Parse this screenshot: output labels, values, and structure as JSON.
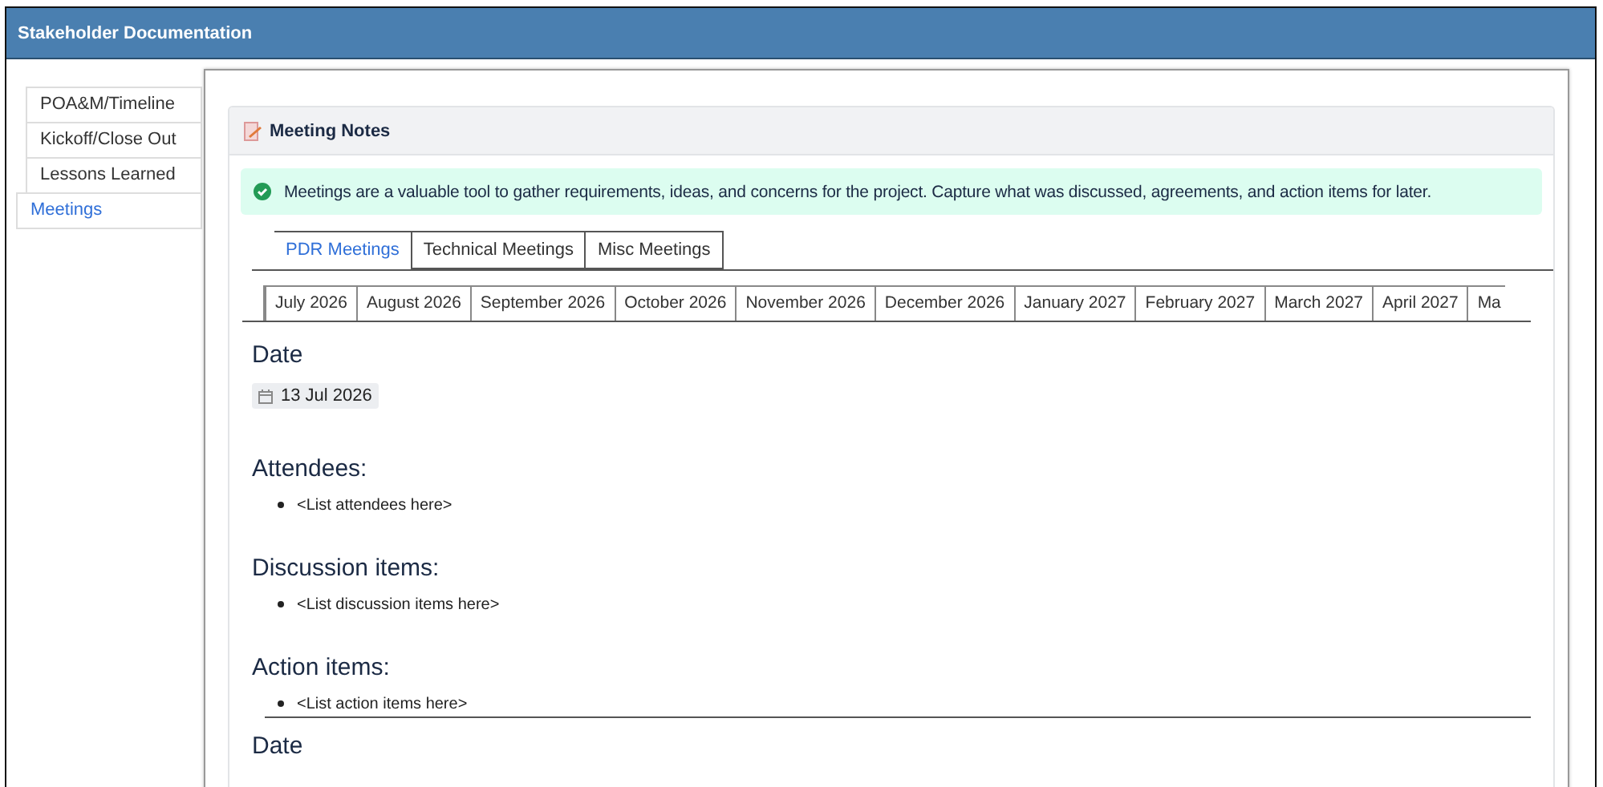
{
  "window": {
    "title": "Stakeholder Documentation"
  },
  "sidebar": {
    "items": [
      {
        "label": "POA&M/Timeline",
        "selected": false
      },
      {
        "label": "Kickoff/Close Out",
        "selected": false
      },
      {
        "label": "Lessons Learned",
        "selected": false
      },
      {
        "label": "Meetings",
        "selected": true
      }
    ]
  },
  "card": {
    "title": "Meeting Notes",
    "alert": "Meetings are a valuable tool to gather requirements, ideas, and concerns for the project. Capture what was discussed, agreements, and action items for later."
  },
  "tabs": [
    {
      "label": "PDR Meetings",
      "selected": true
    },
    {
      "label": "Technical Meetings",
      "selected": false
    },
    {
      "label": "Misc Meetings",
      "selected": false
    }
  ],
  "month_tabs": [
    "July 2026",
    "August 2026",
    "September 2026",
    "October 2026",
    "November 2026",
    "December 2026",
    "January 2027",
    "February 2027",
    "March 2027",
    "April 2027",
    "Ma"
  ],
  "meetings": [
    {
      "date_label": "Date",
      "date": "13 Jul 2026",
      "sections": [
        {
          "heading": "Attendees:",
          "items": [
            "<List attendees here>"
          ]
        },
        {
          "heading": "Discussion items:",
          "items": [
            "<List discussion items here>"
          ]
        },
        {
          "heading": "Action items:",
          "items": [
            "<List action items here>"
          ]
        }
      ]
    },
    {
      "date_label": "Date"
    }
  ]
}
